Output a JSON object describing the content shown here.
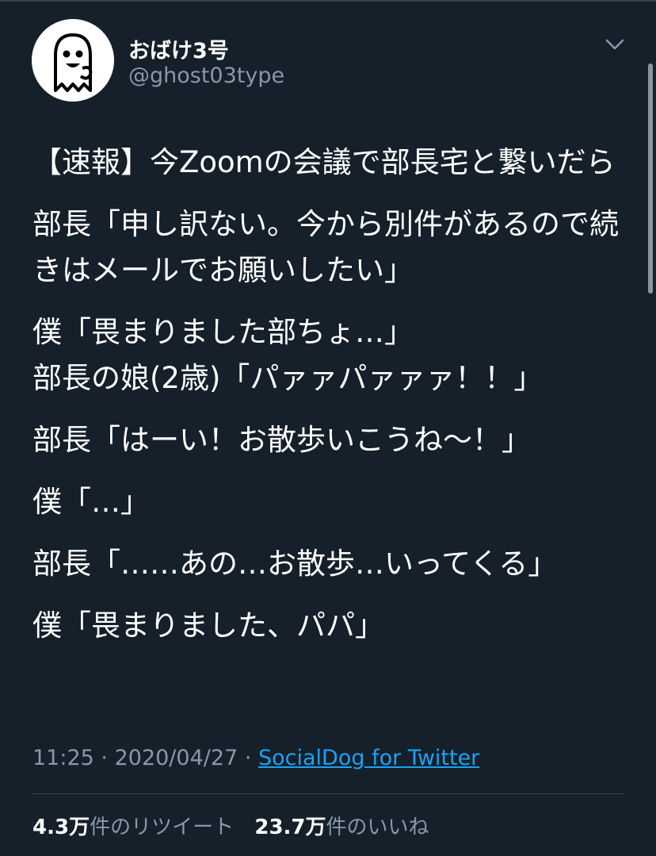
{
  "tweet": {
    "author": {
      "display_name": "おばけ3号",
      "handle": "@ghost03type",
      "avatar_icon": "ghost-icon"
    },
    "menu_icon": "chevron-down-icon",
    "paragraphs": [
      "【速報】今Zoomの会議で部長宅と繋いだら",
      "部長「申し訳ない。今から別件があるので続きはメールでお願いしたい」",
      "僕「畏まりました部ちょ…」\n部長の娘(2歳)「パァァパァァァ！！」",
      "部長「はーい！お散歩いこうね〜！」",
      "僕「…」",
      "部長「……あの…お散歩…いってくる」",
      "僕「畏まりました、パパ」"
    ],
    "time": "11:25",
    "date": "2020/04/27",
    "separator": "·",
    "source": "SocialDog for Twitter",
    "retweets": {
      "count": "4.3",
      "unit": "万",
      "label": "件のリツイート"
    },
    "likes": {
      "count": "23.7",
      "unit": "万",
      "label": "件のいいね"
    }
  },
  "colors": {
    "background": "#15202b",
    "text_primary": "#ffffff",
    "text_secondary": "#8899a6",
    "link": "#1da1f2",
    "divider": "#38444d"
  }
}
